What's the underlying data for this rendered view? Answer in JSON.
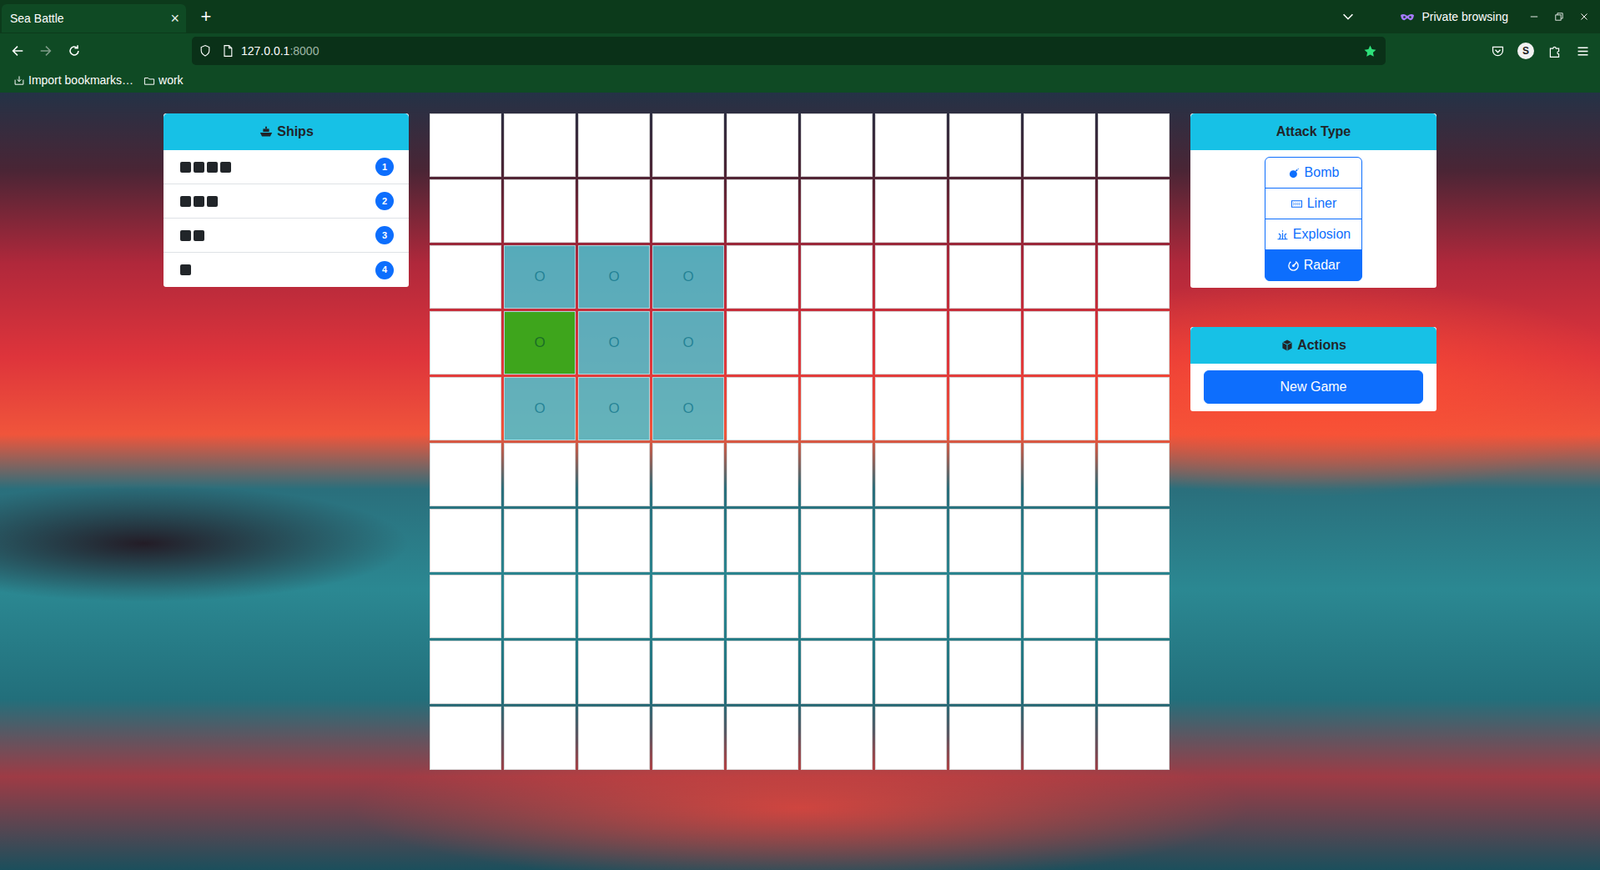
{
  "browser": {
    "tab": {
      "title": "Sea Battle",
      "close": "×",
      "selected": true
    },
    "new_tab": "+",
    "private_label": "Private browsing",
    "url": {
      "host": "127.0.0.1",
      "port": ":8000"
    },
    "bookmarked": true,
    "account_initial": "S",
    "bookmarks": [
      {
        "label": "Import bookmarks…",
        "kind": "import"
      },
      {
        "label": "work",
        "kind": "folder"
      }
    ]
  },
  "ships_panel": {
    "title": "Ships",
    "ships": [
      {
        "length": 4,
        "count": "1"
      },
      {
        "length": 3,
        "count": "2"
      },
      {
        "length": 2,
        "count": "3"
      },
      {
        "length": 1,
        "count": "4"
      }
    ]
  },
  "board": {
    "rows": [
      [
        {
          "text": "",
          "scanned": false,
          "ship": false
        },
        {
          "text": "",
          "scanned": false,
          "ship": false
        },
        {
          "text": "",
          "scanned": false,
          "ship": false
        },
        {
          "text": "",
          "scanned": false,
          "ship": false
        },
        {
          "text": "",
          "scanned": false,
          "ship": false
        },
        {
          "text": "",
          "scanned": false,
          "ship": false
        },
        {
          "text": "",
          "scanned": false,
          "ship": false
        },
        {
          "text": "",
          "scanned": false,
          "ship": false
        },
        {
          "text": "",
          "scanned": false,
          "ship": false
        },
        {
          "text": "",
          "scanned": false,
          "ship": false
        }
      ],
      [
        {
          "text": "",
          "scanned": false,
          "ship": false
        },
        {
          "text": "",
          "scanned": false,
          "ship": false
        },
        {
          "text": "",
          "scanned": false,
          "ship": false
        },
        {
          "text": "",
          "scanned": false,
          "ship": false
        },
        {
          "text": "",
          "scanned": false,
          "ship": false
        },
        {
          "text": "",
          "scanned": false,
          "ship": false
        },
        {
          "text": "",
          "scanned": false,
          "ship": false
        },
        {
          "text": "",
          "scanned": false,
          "ship": false
        },
        {
          "text": "",
          "scanned": false,
          "ship": false
        },
        {
          "text": "",
          "scanned": false,
          "ship": false
        }
      ],
      [
        {
          "text": "",
          "scanned": false,
          "ship": false
        },
        {
          "text": "O",
          "scanned": true,
          "ship": false
        },
        {
          "text": "O",
          "scanned": true,
          "ship": false
        },
        {
          "text": "O",
          "scanned": true,
          "ship": false
        },
        {
          "text": "",
          "scanned": false,
          "ship": false
        },
        {
          "text": "",
          "scanned": false,
          "ship": false
        },
        {
          "text": "",
          "scanned": false,
          "ship": false
        },
        {
          "text": "",
          "scanned": false,
          "ship": false
        },
        {
          "text": "",
          "scanned": false,
          "ship": false
        },
        {
          "text": "",
          "scanned": false,
          "ship": false
        }
      ],
      [
        {
          "text": "",
          "scanned": false,
          "ship": false
        },
        {
          "text": "O",
          "scanned": true,
          "ship": true
        },
        {
          "text": "O",
          "scanned": true,
          "ship": false
        },
        {
          "text": "O",
          "scanned": true,
          "ship": false
        },
        {
          "text": "",
          "scanned": false,
          "ship": false
        },
        {
          "text": "",
          "scanned": false,
          "ship": false
        },
        {
          "text": "",
          "scanned": false,
          "ship": false
        },
        {
          "text": "",
          "scanned": false,
          "ship": false
        },
        {
          "text": "",
          "scanned": false,
          "ship": false
        },
        {
          "text": "",
          "scanned": false,
          "ship": false
        }
      ],
      [
        {
          "text": "",
          "scanned": false,
          "ship": false
        },
        {
          "text": "O",
          "scanned": true,
          "ship": false
        },
        {
          "text": "O",
          "scanned": true,
          "ship": false
        },
        {
          "text": "O",
          "scanned": true,
          "ship": false
        },
        {
          "text": "",
          "scanned": false,
          "ship": false
        },
        {
          "text": "",
          "scanned": false,
          "ship": false
        },
        {
          "text": "",
          "scanned": false,
          "ship": false
        },
        {
          "text": "",
          "scanned": false,
          "ship": false
        },
        {
          "text": "",
          "scanned": false,
          "ship": false
        },
        {
          "text": "",
          "scanned": false,
          "ship": false
        }
      ],
      [
        {
          "text": "",
          "scanned": false,
          "ship": false
        },
        {
          "text": "",
          "scanned": false,
          "ship": false
        },
        {
          "text": "",
          "scanned": false,
          "ship": false
        },
        {
          "text": "",
          "scanned": false,
          "ship": false
        },
        {
          "text": "",
          "scanned": false,
          "ship": false
        },
        {
          "text": "",
          "scanned": false,
          "ship": false
        },
        {
          "text": "",
          "scanned": false,
          "ship": false
        },
        {
          "text": "",
          "scanned": false,
          "ship": false
        },
        {
          "text": "",
          "scanned": false,
          "ship": false
        },
        {
          "text": "",
          "scanned": false,
          "ship": false
        }
      ],
      [
        {
          "text": "",
          "scanned": false,
          "ship": false
        },
        {
          "text": "",
          "scanned": false,
          "ship": false
        },
        {
          "text": "",
          "scanned": false,
          "ship": false
        },
        {
          "text": "",
          "scanned": false,
          "ship": false
        },
        {
          "text": "",
          "scanned": false,
          "ship": false
        },
        {
          "text": "",
          "scanned": false,
          "ship": false
        },
        {
          "text": "",
          "scanned": false,
          "ship": false
        },
        {
          "text": "",
          "scanned": false,
          "ship": false
        },
        {
          "text": "",
          "scanned": false,
          "ship": false
        },
        {
          "text": "",
          "scanned": false,
          "ship": false
        }
      ],
      [
        {
          "text": "",
          "scanned": false,
          "ship": false
        },
        {
          "text": "",
          "scanned": false,
          "ship": false
        },
        {
          "text": "",
          "scanned": false,
          "ship": false
        },
        {
          "text": "",
          "scanned": false,
          "ship": false
        },
        {
          "text": "",
          "scanned": false,
          "ship": false
        },
        {
          "text": "",
          "scanned": false,
          "ship": false
        },
        {
          "text": "",
          "scanned": false,
          "ship": false
        },
        {
          "text": "",
          "scanned": false,
          "ship": false
        },
        {
          "text": "",
          "scanned": false,
          "ship": false
        },
        {
          "text": "",
          "scanned": false,
          "ship": false
        }
      ],
      [
        {
          "text": "",
          "scanned": false,
          "ship": false
        },
        {
          "text": "",
          "scanned": false,
          "ship": false
        },
        {
          "text": "",
          "scanned": false,
          "ship": false
        },
        {
          "text": "",
          "scanned": false,
          "ship": false
        },
        {
          "text": "",
          "scanned": false,
          "ship": false
        },
        {
          "text": "",
          "scanned": false,
          "ship": false
        },
        {
          "text": "",
          "scanned": false,
          "ship": false
        },
        {
          "text": "",
          "scanned": false,
          "ship": false
        },
        {
          "text": "",
          "scanned": false,
          "ship": false
        },
        {
          "text": "",
          "scanned": false,
          "ship": false
        }
      ],
      [
        {
          "text": "",
          "scanned": false,
          "ship": false
        },
        {
          "text": "",
          "scanned": false,
          "ship": false
        },
        {
          "text": "",
          "scanned": false,
          "ship": false
        },
        {
          "text": "",
          "scanned": false,
          "ship": false
        },
        {
          "text": "",
          "scanned": false,
          "ship": false
        },
        {
          "text": "",
          "scanned": false,
          "ship": false
        },
        {
          "text": "",
          "scanned": false,
          "ship": false
        },
        {
          "text": "",
          "scanned": false,
          "ship": false
        },
        {
          "text": "",
          "scanned": false,
          "ship": false
        },
        {
          "text": "",
          "scanned": false,
          "ship": false
        }
      ]
    ]
  },
  "attack_panel": {
    "title": "Attack Type",
    "options": [
      {
        "label": "Bomb",
        "kind": "bomb",
        "selected": false
      },
      {
        "label": "Liner",
        "kind": "liner",
        "selected": false
      },
      {
        "label": "Explosion",
        "kind": "explosion",
        "selected": false
      },
      {
        "label": "Radar",
        "kind": "radar",
        "selected": true
      }
    ]
  },
  "actions_panel": {
    "title": "Actions",
    "buttons": [
      "New Game"
    ]
  }
}
